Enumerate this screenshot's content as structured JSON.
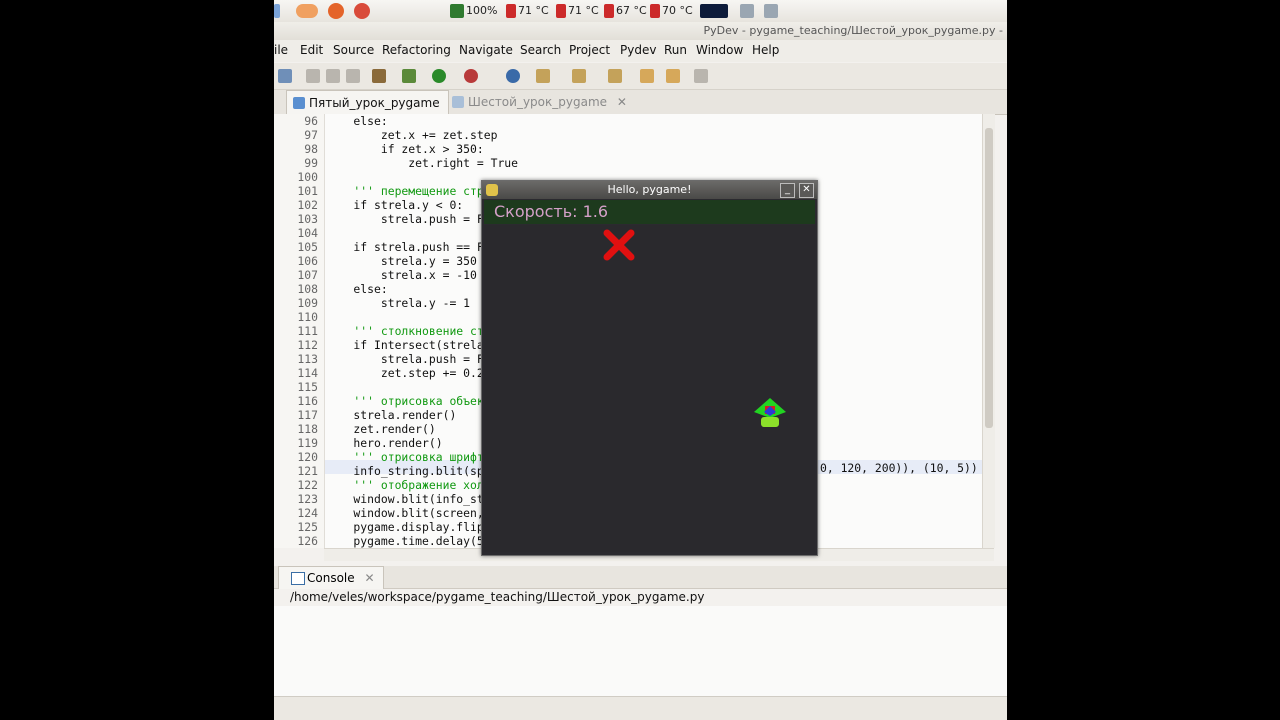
{
  "panel": {
    "battery": "100%",
    "temps": [
      "71 °C",
      "71 °C",
      "67 °C",
      "70 °C"
    ]
  },
  "window": {
    "title": "PyDev - pygame_teaching/Шестой_урок_pygame.py -"
  },
  "menu": [
    "ile",
    "Edit",
    "Source",
    "Refactoring",
    "Navigate",
    "Search",
    "Project",
    "Pydev",
    "Run",
    "Window",
    "Help"
  ],
  "tabs": [
    {
      "label": "Пятый_урок_pygame",
      "active": true
    },
    {
      "label": "Шестой_урок_pygame",
      "active": false,
      "close": "✕"
    }
  ],
  "editor": {
    "lines": [
      {
        "n": "96",
        "t": "    else:"
      },
      {
        "n": "97",
        "t": "        zet.x += zet.step"
      },
      {
        "n": "98",
        "t": "        if zet.x > 350:"
      },
      {
        "n": "99",
        "t": "            zet.right = True"
      },
      {
        "n": "100",
        "t": ""
      },
      {
        "n": "101",
        "t": "    ''' перемещение стр"
      },
      {
        "n": "102",
        "t": "    if strela.y < 0:"
      },
      {
        "n": "103",
        "t": "        strela.push = Fa"
      },
      {
        "n": "104",
        "t": ""
      },
      {
        "n": "105",
        "t": "    if strela.push == Fa"
      },
      {
        "n": "106",
        "t": "        strela.y = 350"
      },
      {
        "n": "107",
        "t": "        strela.x = -10"
      },
      {
        "n": "108",
        "t": "    else:"
      },
      {
        "n": "109",
        "t": "        strela.y -= 1"
      },
      {
        "n": "110",
        "t": ""
      },
      {
        "n": "111",
        "t": "    ''' столкновение ст"
      },
      {
        "n": "112",
        "t": "    if Intersect(strela"
      },
      {
        "n": "113",
        "t": "        strela.push = Fa"
      },
      {
        "n": "114",
        "t": "        zet.step += 0.2"
      },
      {
        "n": "115",
        "t": ""
      },
      {
        "n": "116",
        "t": "    ''' отрисовка объек"
      },
      {
        "n": "117",
        "t": "    strela.render()"
      },
      {
        "n": "118",
        "t": "    zet.render()"
      },
      {
        "n": "119",
        "t": "    hero.render()"
      },
      {
        "n": "120",
        "t": "    ''' отрисовка шрифт"
      },
      {
        "n": "121",
        "t": "    info_string.blit(sp"
      },
      {
        "n": "122",
        "t": "    ''' отображение хол"
      },
      {
        "n": "123",
        "t": "    window.blit(info_st"
      },
      {
        "n": "124",
        "t": "    window.blit(screen,"
      },
      {
        "n": "125",
        "t": "    pygame.display.flip"
      },
      {
        "n": "126",
        "t": "    pygame.time.delay(5"
      }
    ],
    "line121_tail": "0, 120, 200)), (10, 5))"
  },
  "console": {
    "tab_label": "Console",
    "close": "✕",
    "path": "/home/veles/workspace/pygame_teaching/Шестой_урок_pygame.py"
  },
  "pygame": {
    "title": "Hello, pygame!",
    "speed_text": "Скорость: 1.6",
    "min_label": "_",
    "close_label": "✕",
    "bg": "#2a292d",
    "status_bg": "#1d3a1d",
    "speed_color": "#d4a0c8",
    "target_color": "#e01010",
    "hero_colors": [
      "#22d422",
      "#d81e1e",
      "#2a3ad8",
      "#8ce02a"
    ]
  }
}
